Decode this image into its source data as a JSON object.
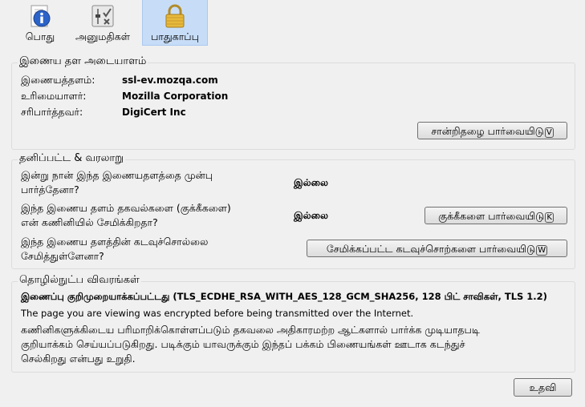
{
  "tabs": [
    {
      "label": "பொது",
      "icon": "info-icon"
    },
    {
      "label": "அனுமதிகள்",
      "icon": "permissions-icon"
    },
    {
      "label": "பாதுகாப்பு",
      "icon": "padlock-icon",
      "selected": true
    }
  ],
  "identity": {
    "title": "இணைய தள அடையாளம்",
    "website_label": "இணையத்தளம்:",
    "website_value": "ssl-ev.mozqa.com",
    "owner_label": "உரிமையாளர்:",
    "owner_value": "Mozilla Corporation",
    "verifier_label": "சரிபார்த்தவர்:",
    "verifier_value": "DigiCert Inc",
    "view_cert_button": "சான்றிதழை பார்வையிடு",
    "view_cert_key": "V"
  },
  "privacy": {
    "title": "தனிப்பட்ட & வரலாறு",
    "visited_q1": "இன்று நான் இந்த இணையதளத்தை முன்பு",
    "visited_q2": "பார்த்தேனா?",
    "visited_a": "இல்லை",
    "cookies_q1": "இந்த இணைய தளம் தகவல்களை (குக்கீகளை)",
    "cookies_q2": "என் கணினியில் சேமிக்கிறதா?",
    "cookies_a": "இல்லை",
    "view_cookies_button": "குக்கீகளை பார்வையிடு",
    "view_cookies_key": "K",
    "passwords_q1": "இந்த இணைய தளத்தின் கடவுச்சொல்லை",
    "passwords_q2": "சேமித்துள்ளேனா?",
    "view_passwords_button": "சேமிக்கப்பட்ட கடவுச்சொற்களை பார்வையிடு",
    "view_passwords_key": "W"
  },
  "technical": {
    "title": "தொழில்நுட்ப விவரங்கள்",
    "encryption": "இணைப்பு குறிமுறையாக்கப்பட்டது (TLS_ECDHE_RSA_WITH_AES_128_GCM_SHA256, 128 பிட் சாவிகள், TLS 1.2)",
    "english_note": "The page you are viewing was encrypted before being transmitted over the Internet.",
    "desc1": "கணினிகளுக்கிடைய பரிமாறிக்கொள்ளப்படும் தகவலை அதிகாரமற்ற ஆட்களால் பார்க்க முடியாதபடி",
    "desc2": "குறியாக்கம் செய்யப்படுகிறது. படிக்கும் யாவருக்கும் இந்தப் பக்கம் பிணையங்கள் ஊடாக கடந்துச்",
    "desc3": "செல்கிறது என்பது உறுதி."
  },
  "help_button": "உதவி"
}
